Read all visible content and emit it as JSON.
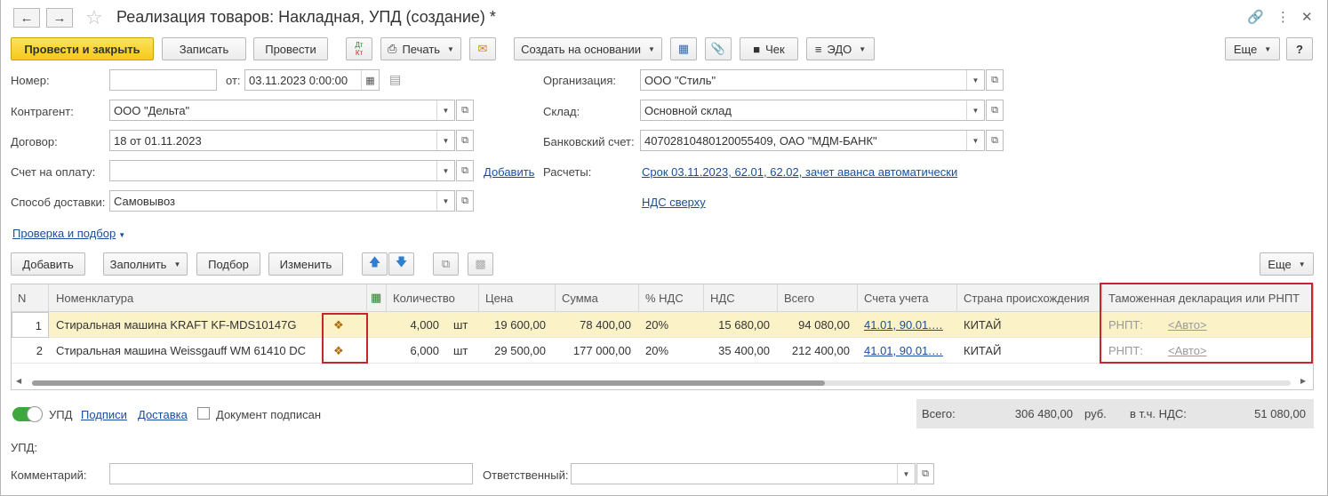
{
  "window": {
    "title": "Реализация товаров: Накладная, УПД (создание) *",
    "back_icon": "arrow-left-icon",
    "forward_icon": "arrow-right-icon"
  },
  "toolbar": {
    "post_close": "Провести и закрыть",
    "save": "Записать",
    "post": "Провести",
    "dtkt_top": "Дт",
    "dtkt_bottom": "Кт",
    "print": "Печать",
    "create_based": "Создать на основании",
    "check": "Чек",
    "edo": "ЭДО",
    "more": "Еще",
    "help": "?"
  },
  "form": {
    "number_label": "Номер:",
    "number_value": "",
    "date_label": "от:",
    "date_value": "03.11.2023  0:00:00",
    "org_label": "Организация:",
    "org_value": "ООО \"Стиль\"",
    "counterparty_label": "Контрагент:",
    "counterparty_value": "ООО \"Дельта\"",
    "warehouse_label": "Склад:",
    "warehouse_value": "Основной склад",
    "contract_label": "Договор:",
    "contract_value": "18 от 01.11.2023",
    "bank_label": "Банковский счет:",
    "bank_value": "40702810480120055409, ОАО \"МДМ-БАНК\"",
    "invoice_label": "Счет на оплату:",
    "invoice_value": "",
    "add_link": "Добавить",
    "settlements_label": "Расчеты:",
    "settlements_link": "Срок 03.11.2023, 62.01, 62.02, зачет аванса автоматически",
    "delivery_label": "Способ доставки:",
    "delivery_value": "Самовывоз",
    "vat_link": "НДС сверху",
    "check_link": "Проверка и подбор"
  },
  "table_toolbar": {
    "add": "Добавить",
    "fill": "Заполнить",
    "pick": "Подбор",
    "change": "Изменить",
    "more": "Еще"
  },
  "table": {
    "headers": [
      "N",
      "Номенклатура",
      "Количество",
      "Цена",
      "Сумма",
      "% НДС",
      "НДС",
      "Всего",
      "Счета учета",
      "Страна происхождения",
      "Таможенная декларация или РНПТ"
    ],
    "rows": [
      {
        "n": "1",
        "name": "Стиральная машина KRAFT KF-MDS10147G",
        "qty": "4,000",
        "unit": "шт",
        "price": "19 600,00",
        "sum": "78 400,00",
        "vat_rate": "20%",
        "vat": "15 680,00",
        "total": "94 080,00",
        "accounts": "41.01, 90.01.…",
        "country": "КИТАЙ",
        "rnpt_label": "РНПТ:",
        "rnpt_value": "<Авто>"
      },
      {
        "n": "2",
        "name": "Стиральная машина Weissgauff WM 61410 DC",
        "qty": "6,000",
        "unit": "шт",
        "price": "29 500,00",
        "sum": "177 000,00",
        "vat_rate": "20%",
        "vat": "35 400,00",
        "total": "212 400,00",
        "accounts": "41.01, 90.01.…",
        "country": "КИТАЙ",
        "rnpt_label": "РНПТ:",
        "rnpt_value": "<Авто>"
      }
    ]
  },
  "footer": {
    "upd_toggle": "УПД",
    "signatures_link": "Подписи",
    "delivery_link": "Доставка",
    "signed_label": "Документ подписан",
    "total_label": "Всего:",
    "total_value": "306 480,00",
    "currency": "руб.",
    "vat_label": "в т.ч. НДС:",
    "vat_value": "51 080,00",
    "upd_label": "УПД:",
    "comment_label": "Комментарий:",
    "comment_value": "",
    "responsible_label": "Ответственный:",
    "responsible_value": ""
  }
}
